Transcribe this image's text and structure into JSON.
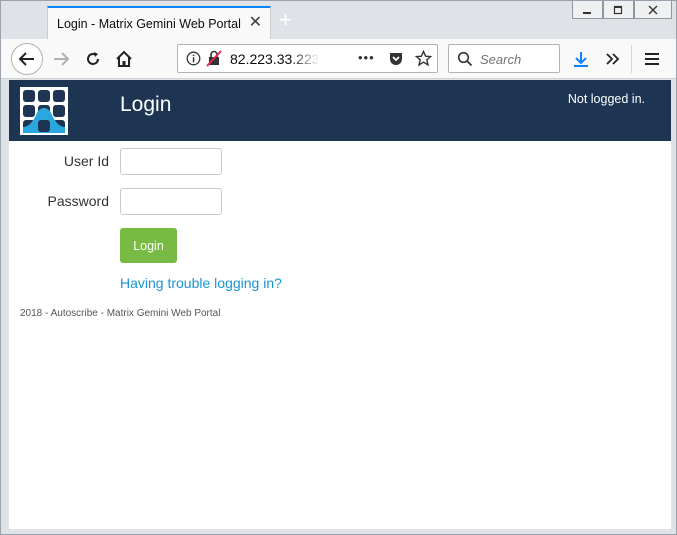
{
  "browser": {
    "tab_title": "Login - Matrix Gemini Web Portal",
    "tab_close": "✕",
    "new_tab": "+",
    "url": "82.223.33.223",
    "search_placeholder": "Search",
    "more": "•••",
    "menu": "≡"
  },
  "header": {
    "title": "Login",
    "status": "Not logged in."
  },
  "form": {
    "userid_label": "User Id",
    "userid_value": "",
    "password_label": "Password",
    "password_value": "",
    "login_label": "Login",
    "trouble_link": "Having trouble logging in?"
  },
  "footer": {
    "text": "2018 - Autoscribe - Matrix Gemini Web Portal"
  },
  "colors": {
    "header_bg": "#1d3452",
    "login_button": "#77bb44",
    "link": "#1a94d4",
    "accent": "#0a84ff"
  }
}
